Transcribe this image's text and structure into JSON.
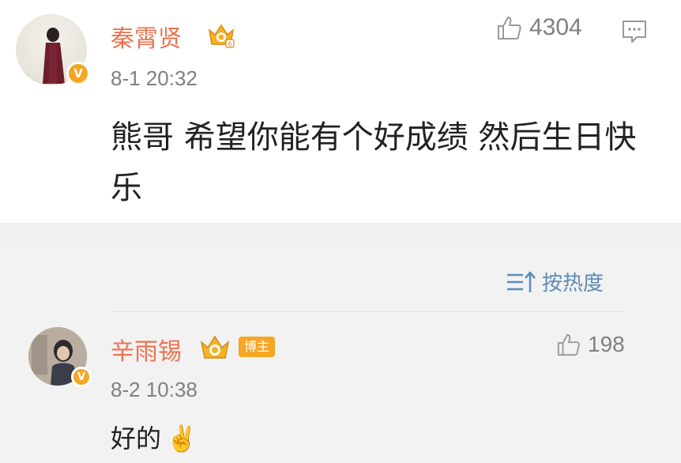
{
  "post": {
    "username": "秦霄贤",
    "timestamp": "8-1 20:32",
    "like_count": "4304",
    "content": "熊哥  希望你能有个好成绩  然后生日快乐",
    "avatar_badge": "V"
  },
  "sort": {
    "label": "按热度"
  },
  "reply": {
    "username": "辛雨锡",
    "blogger_badge": "博主",
    "timestamp": "8-2 10:38",
    "like_count": "198",
    "content": "好的",
    "content_emoji": "✌️",
    "avatar_badge": "V"
  },
  "colors": {
    "username": "#eb7350",
    "badge": "#f5a623",
    "sort_link": "#5d8bb8",
    "muted": "#808080"
  },
  "icons": {
    "crown": "vip-crown-icon",
    "like": "thumbs-up-icon",
    "comment": "comment-icon",
    "sort": "sort-icon",
    "verified": "verified-v-icon"
  }
}
